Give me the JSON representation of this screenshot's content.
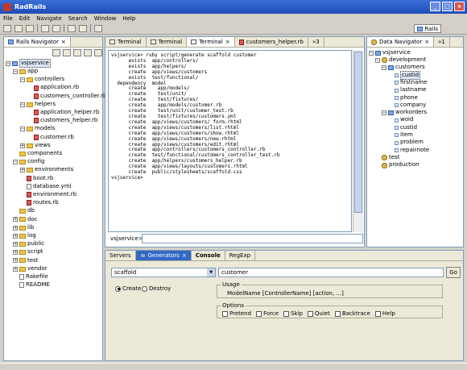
{
  "window": {
    "title": "RadRails",
    "minimize": "_",
    "maximize": "□",
    "close": "×"
  },
  "menu": [
    "File",
    "Edit",
    "Navigate",
    "Search",
    "Window",
    "Help"
  ],
  "perspective": {
    "label": "Rails"
  },
  "rails_navigator": {
    "title": "Rails Navigator",
    "rows": [
      {
        "label": "vsjservice",
        "depth": 0,
        "kind": "project",
        "expander": "−",
        "selected": true
      },
      {
        "label": "app",
        "depth": 1,
        "kind": "folder",
        "expander": "−"
      },
      {
        "label": "controllers",
        "depth": 2,
        "kind": "folder",
        "expander": "−"
      },
      {
        "label": "application.rb",
        "depth": 3,
        "kind": "rb"
      },
      {
        "label": "customers_controller.rb",
        "depth": 3,
        "kind": "rb"
      },
      {
        "label": "helpers",
        "depth": 2,
        "kind": "folder",
        "expander": "−"
      },
      {
        "label": "application_helper.rb",
        "depth": 3,
        "kind": "rb"
      },
      {
        "label": "customers_helper.rb",
        "depth": 3,
        "kind": "rb"
      },
      {
        "label": "models",
        "depth": 2,
        "kind": "folder",
        "expander": "−"
      },
      {
        "label": "customer.rb",
        "depth": 3,
        "kind": "rb"
      },
      {
        "label": "views",
        "depth": 2,
        "kind": "folder",
        "expander": "+"
      },
      {
        "label": "components",
        "depth": 1,
        "kind": "folder"
      },
      {
        "label": "config",
        "depth": 1,
        "kind": "folder",
        "expander": "−"
      },
      {
        "label": "environments",
        "depth": 2,
        "kind": "folder",
        "expander": "+"
      },
      {
        "label": "boot.rb",
        "depth": 2,
        "kind": "rb"
      },
      {
        "label": "database.yml",
        "depth": 2,
        "kind": "file"
      },
      {
        "label": "environment.rb",
        "depth": 2,
        "kind": "rb"
      },
      {
        "label": "routes.rb",
        "depth": 2,
        "kind": "rb"
      },
      {
        "label": "db",
        "depth": 1,
        "kind": "folder"
      },
      {
        "label": "doc",
        "depth": 1,
        "kind": "folder",
        "expander": "+"
      },
      {
        "label": "lib",
        "depth": 1,
        "kind": "folder",
        "expander": "+"
      },
      {
        "label": "log",
        "depth": 1,
        "kind": "folder",
        "expander": "+"
      },
      {
        "label": "public",
        "depth": 1,
        "kind": "folder",
        "expander": "+"
      },
      {
        "label": "script",
        "depth": 1,
        "kind": "folder",
        "expander": "+"
      },
      {
        "label": "test",
        "depth": 1,
        "kind": "folder",
        "expander": "+"
      },
      {
        "label": "vendor",
        "depth": 1,
        "kind": "folder",
        "expander": "+"
      },
      {
        "label": "Rakefile",
        "depth": 1,
        "kind": "file"
      },
      {
        "label": "README",
        "depth": 1,
        "kind": "file"
      }
    ]
  },
  "editor_tabs": [
    "Terminal",
    "Terminal",
    "Terminal",
    "customers_helper.rb",
    "»3"
  ],
  "terminal": {
    "lines": [
      "vsjservice> ruby script/generate scaffold customer",
      "      exists  app/controllers/",
      "      exists  app/helpers/",
      "      create  app/views/customers",
      "      exists  test/functional/",
      "  dependency  model",
      "      create    app/models/",
      "      create    test/unit/",
      "      create    test/fixtures/",
      "      create    app/models/customer.rb",
      "      create    test/unit/customer_test.rb",
      "      create    test/fixtures/customers.yml",
      "      create  app/views/customers/_form.rhtml",
      "      create  app/views/customers/list.rhtml",
      "      create  app/views/customers/show.rhtml",
      "      create  app/views/customers/new.rhtml",
      "      create  app/views/customers/edit.rhtml",
      "      create  app/controllers/customers_controller.rb",
      "      create  test/functional/customers_controller_test.rb",
      "      create  app/helpers/customers_helper.rb",
      "      create  app/views/layouts/customers.rhtml",
      "      create  public/stylesheets/scaffold.css",
      "vsjservice>"
    ],
    "prompt": "vsjservice>"
  },
  "data_navigator": {
    "title": "Data Navigator",
    "tab_extra": "»1",
    "rows": [
      {
        "label": "vsjservice",
        "depth": 0,
        "kind": "project",
        "expander": "−"
      },
      {
        "label": "development",
        "depth": 1,
        "kind": "db",
        "expander": "−"
      },
      {
        "label": "customers",
        "depth": 2,
        "kind": "table",
        "expander": "−"
      },
      {
        "label": "custid",
        "depth": 3,
        "kind": "col",
        "selected": true
      },
      {
        "label": "firstname",
        "depth": 3,
        "kind": "col"
      },
      {
        "label": "lastname",
        "depth": 3,
        "kind": "col"
      },
      {
        "label": "phone",
        "depth": 3,
        "kind": "col"
      },
      {
        "label": "company",
        "depth": 3,
        "kind": "col"
      },
      {
        "label": "workorders",
        "depth": 2,
        "kind": "table",
        "expander": "−"
      },
      {
        "label": "woid",
        "depth": 3,
        "kind": "col"
      },
      {
        "label": "custid",
        "depth": 3,
        "kind": "col"
      },
      {
        "label": "item",
        "depth": 3,
        "kind": "col"
      },
      {
        "label": "problem",
        "depth": 3,
        "kind": "col"
      },
      {
        "label": "repairnote",
        "depth": 3,
        "kind": "col"
      },
      {
        "label": "test",
        "depth": 1,
        "kind": "db"
      },
      {
        "label": "production",
        "depth": 1,
        "kind": "db"
      }
    ]
  },
  "bottom_tabs": [
    "Servers",
    "Generators",
    "Console",
    "RegExp"
  ],
  "generators": {
    "generator_value": "scaffold",
    "name_value": "customer",
    "go_label": "Go",
    "mode_create": "Create",
    "mode_destroy": "Destroy",
    "usage_title": "Usage",
    "usage_text": "ModelName [ControllerName] [action, ...]",
    "options_title": "Options",
    "options": [
      "Pretend",
      "Force",
      "Skip",
      "Quiet",
      "Backtrace",
      "Help"
    ]
  }
}
